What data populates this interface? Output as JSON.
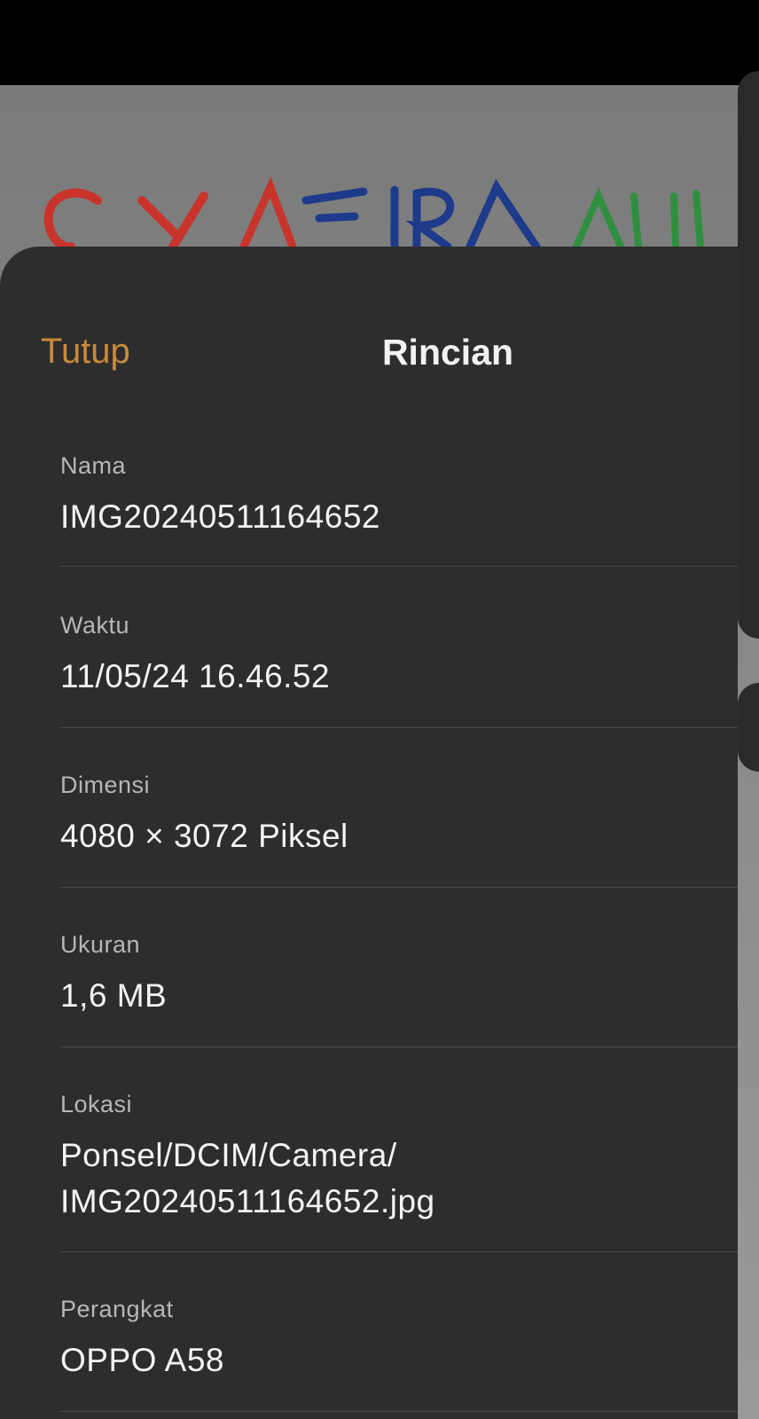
{
  "header": {
    "close_label": "Tutup",
    "title": "Rincian"
  },
  "details": {
    "name": {
      "label": "Nama",
      "value": "IMG20240511164652"
    },
    "time": {
      "label": "Waktu",
      "value": "11/05/24 16.46.52"
    },
    "dimension": {
      "label": "Dimensi",
      "value": "4080 × 3072 Piksel"
    },
    "size": {
      "label": "Ukuran",
      "value": "1,6 MB"
    },
    "location": {
      "label": "Lokasi",
      "value_line1": "Ponsel/DCIM/Camera/",
      "value_line2": "IMG20240511164652.jpg"
    },
    "device": {
      "label": "Perangkat",
      "value": "OPPO A58"
    }
  },
  "colors": {
    "accent": "#c98a3c",
    "sheet_background": "#2d2d2d",
    "label_text": "#b7b7b7",
    "value_text": "#f4f4f4"
  }
}
